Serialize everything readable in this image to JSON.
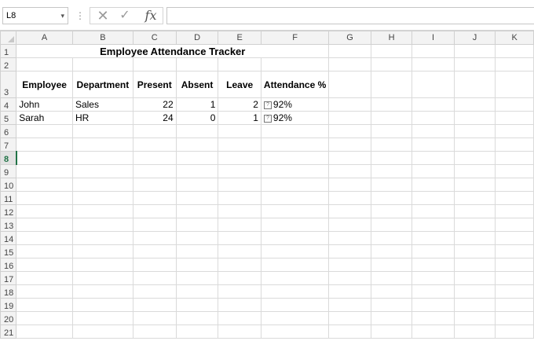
{
  "formula_bar": {
    "name_box": "L8",
    "options_icon": "vertical-dots-icon",
    "cancel_icon": "cancel-x-icon",
    "enter_icon": "checkmark-icon",
    "function_icon": "fx-icon",
    "fx_label": "fx",
    "formula": ""
  },
  "columns": [
    "A",
    "B",
    "C",
    "D",
    "E",
    "F",
    "G",
    "H",
    "I",
    "J",
    "K"
  ],
  "rows": [
    "1",
    "2",
    "3",
    "4",
    "5",
    "6",
    "7",
    "8",
    "9",
    "10",
    "11",
    "12",
    "13",
    "14",
    "15",
    "16",
    "17",
    "18",
    "19",
    "20",
    "21"
  ],
  "sheet": {
    "title": "Employee Attendance Tracker",
    "headers": [
      "Employee",
      "Department",
      "Present",
      "Absent",
      "Leave",
      "Attendance %"
    ],
    "data": [
      {
        "employee": "John",
        "department": "Sales",
        "present": "22",
        "absent": "1",
        "leave": "2",
        "attendance": "92%"
      },
      {
        "employee": "Sarah",
        "department": "HR",
        "present": "24",
        "absent": "0",
        "leave": "1",
        "attendance": "92%"
      }
    ],
    "active_row": "8"
  }
}
